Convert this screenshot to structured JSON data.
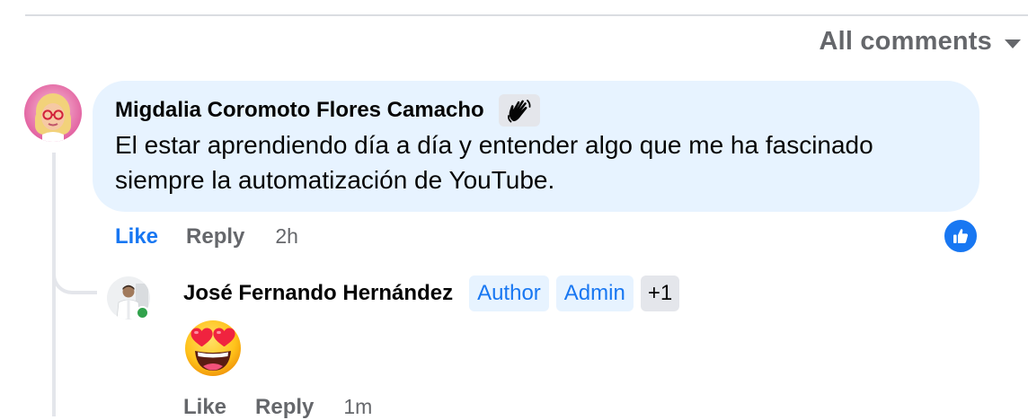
{
  "sort": {
    "label": "All comments"
  },
  "comment": {
    "author": "Migdalia Coromoto Flores Camacho",
    "badge_icon": "wave-hand-icon",
    "text_line1": "El estar aprendiendo día a día y entender algo que me ha fascinado",
    "text_line2": "siempre la automatización de YouTube.",
    "actions": {
      "like": "Like",
      "reply": "Reply",
      "time": "2h"
    },
    "reaction_icon": "thumbs-up-icon"
  },
  "reply": {
    "author": "José Fernando Hernández",
    "tags": [
      "Author",
      "Admin"
    ],
    "more_tags": "+1",
    "content_icon": "heart-eyes-emoji-icon",
    "actions": {
      "like": "Like",
      "reply": "Reply",
      "time": "1m"
    },
    "online": true
  },
  "colors": {
    "accent": "#1877f2",
    "bubble": "#e7f3ff",
    "muted": "#65676b",
    "online": "#31a24c"
  }
}
